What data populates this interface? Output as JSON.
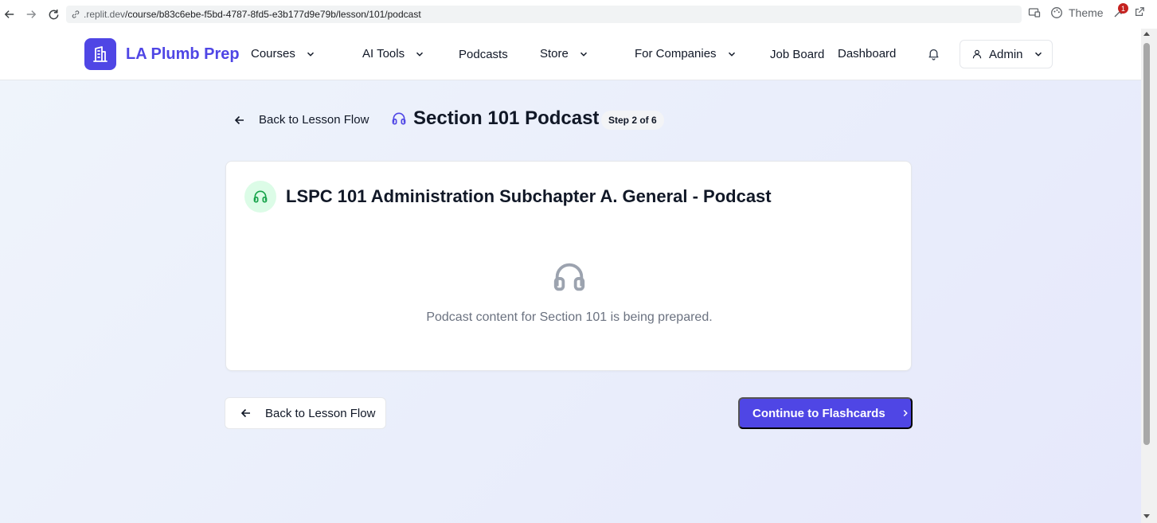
{
  "browser": {
    "url_prefix": ".replit.dev",
    "url_path": "/course/b83c6ebe-f5bd-4787-8fd5-e3b177d9e79b/lesson/101/podcast",
    "theme_label": "Theme",
    "extension_badge": "1"
  },
  "header": {
    "brand": "LA Plumb Prep",
    "nav": {
      "courses": "Courses",
      "ai_tools": "AI Tools",
      "podcasts": "Podcasts",
      "store": "Store",
      "for_companies": "For Companies",
      "job_board": "Job Board",
      "dashboard": "Dashboard"
    },
    "user_label": "Admin"
  },
  "page": {
    "back_link": "Back to Lesson Flow",
    "title": "Section 101 Podcast",
    "step": "Step 2 of 6"
  },
  "card": {
    "title": "LSPC 101 Administration Subchapter A. General - Podcast",
    "message": "Podcast content for Section 101 is being prepared."
  },
  "actions": {
    "back_label": "Back to Lesson Flow",
    "continue_label": "Continue to Flashcards"
  },
  "colors": {
    "primary": "#4f46e5",
    "podcast_icon_bg": "#dcfce7",
    "podcast_icon": "#16a34a"
  },
  "icons": [
    "back-icon",
    "forward-icon",
    "reload-icon",
    "link-icon",
    "cast-icon",
    "palette-icon",
    "extension-icon",
    "open-external-icon",
    "building-icon",
    "chevron-down-icon",
    "bell-icon",
    "user-icon",
    "arrow-left-icon",
    "headphones-icon",
    "chevron-right-icon"
  ]
}
